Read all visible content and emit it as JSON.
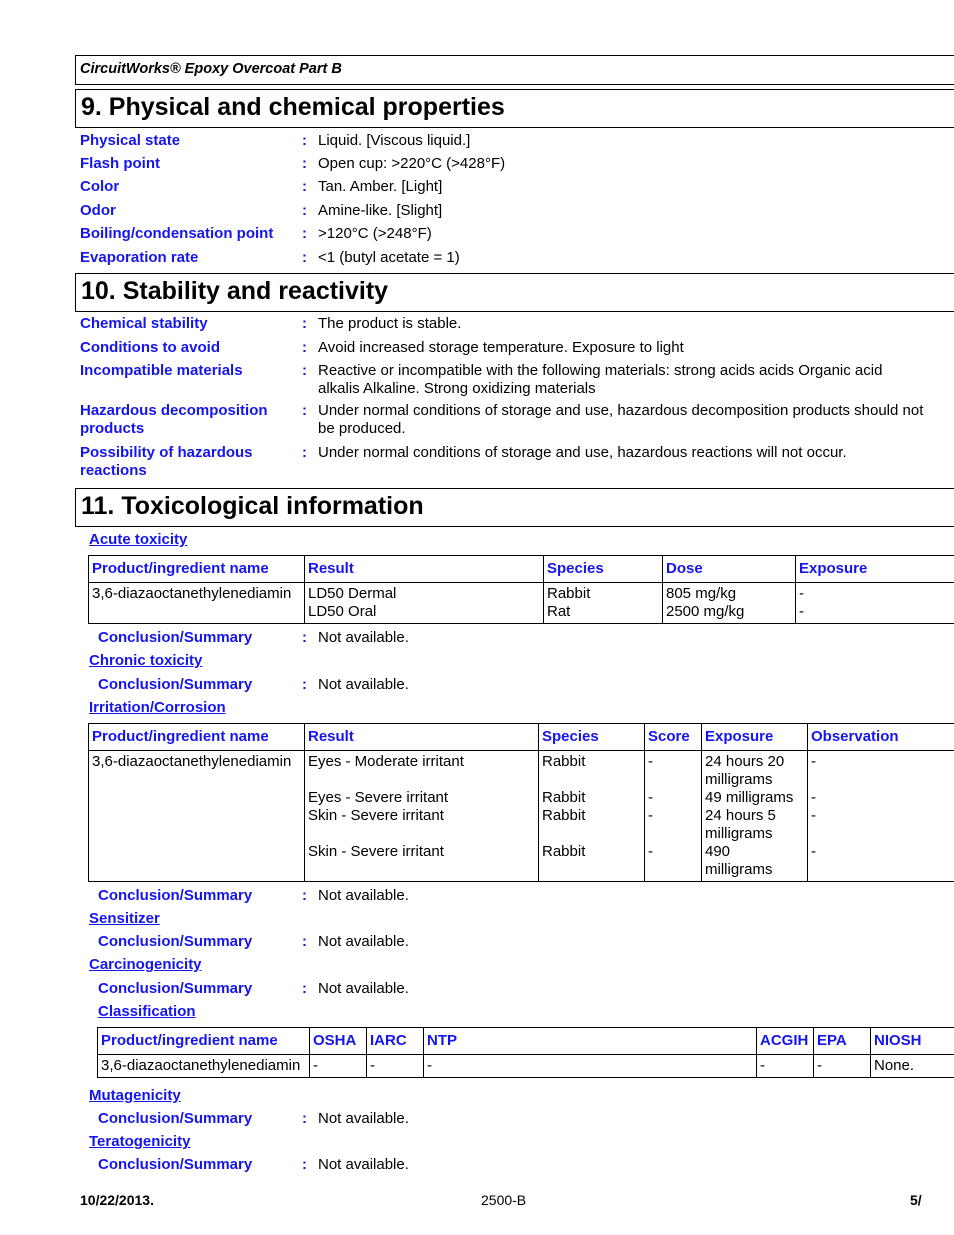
{
  "header": {
    "product": "CircuitWorks® Epoxy Overcoat Part B"
  },
  "section9": {
    "title": "9. Physical and chemical properties",
    "rows": [
      {
        "label": "Physical state",
        "value": "Liquid. [Viscous liquid.]"
      },
      {
        "label": "Flash point",
        "value": "Open cup: >220°C (>428°F)"
      },
      {
        "label": "Color",
        "value": "Tan. Amber. [Light]"
      },
      {
        "label": "Odor",
        "value": "Amine-like. [Slight]"
      },
      {
        "label": "Boiling/condensation point",
        "value": ">120°C (>248°F)"
      },
      {
        "label": "Evaporation rate",
        "value": "<1 (butyl acetate = 1)"
      }
    ]
  },
  "section10": {
    "title": "10. Stability and reactivity",
    "rows": [
      {
        "label": "Chemical stability",
        "value": "The product is stable."
      },
      {
        "label": "Conditions to avoid",
        "value": "Avoid increased storage temperature. Exposure to light"
      },
      {
        "label": "Incompatible materials",
        "value": "Reactive or incompatible with the following materials: strong acids acids Organic acid alkalis Alkaline. Strong oxidizing materials"
      },
      {
        "label": "Hazardous decomposition products",
        "value": "Under normal conditions of storage and use, hazardous decomposition products should not be produced."
      },
      {
        "label": "Possibility of hazardous reactions",
        "value": "Under normal conditions of storage and use, hazardous reactions will not occur."
      }
    ]
  },
  "section11": {
    "title": "11. Toxicological information",
    "colon": ":",
    "conclusion_label": "Conclusion/Summary",
    "not_available": "Not available.",
    "acute": {
      "heading": "Acute toxicity",
      "columns": [
        "Product/ingredient name",
        "Result",
        "Species",
        "Dose",
        "Exposure"
      ],
      "row": {
        "name": "3,6-diazaoctanethylenediamin",
        "results": [
          "LD50 Dermal",
          "LD50 Oral"
        ],
        "species": [
          "Rabbit",
          "Rat"
        ],
        "doses": [
          "805 mg/kg",
          "2500 mg/kg"
        ],
        "exposures": [
          "-",
          "-"
        ]
      }
    },
    "chronic": {
      "heading": "Chronic toxicity"
    },
    "irritation": {
      "heading": "Irritation/Corrosion",
      "columns": [
        "Product/ingredient name",
        "Result",
        "Species",
        "Score",
        "Exposure",
        "Observation"
      ],
      "row": {
        "name": "3,6-diazaoctanethylenediamin",
        "entries": [
          {
            "result": "Eyes - Moderate irritant",
            "species": "Rabbit",
            "score": "-",
            "exposure_1": "24 hours 20",
            "exposure_2": "milligrams",
            "observation": "-"
          },
          {
            "result": "Eyes - Severe irritant",
            "species": "Rabbit",
            "score": "-",
            "exposure_1": "49 milligrams",
            "exposure_2": "",
            "observation": "-"
          },
          {
            "result": "Skin - Severe irritant",
            "species": "Rabbit",
            "score": "-",
            "exposure_1": "24 hours 5",
            "exposure_2": "milligrams",
            "observation": "-"
          },
          {
            "result": "Skin - Severe irritant",
            "species": "Rabbit",
            "score": "-",
            "exposure_1": "490",
            "exposure_2": "milligrams",
            "observation": "-"
          }
        ]
      }
    },
    "sensitizer": {
      "heading": "Sensitizer"
    },
    "carcinogenicity": {
      "heading": "Carcinogenicity"
    },
    "classification": {
      "heading": "Classification",
      "columns": [
        "Product/ingredient name",
        "OSHA",
        "IARC",
        "NTP",
        "ACGIH",
        "EPA",
        "NIOSH"
      ],
      "row": [
        "3,6-diazaoctanethylenediamin",
        "-",
        "-",
        "-",
        "-",
        "-",
        "None."
      ]
    },
    "mutagenicity": {
      "heading": "Mutagenicity"
    },
    "teratogenicity": {
      "heading": "Teratogenicity"
    }
  },
  "footer": {
    "date": "10/22/2013.",
    "code": "2500-B",
    "page": "5/"
  }
}
